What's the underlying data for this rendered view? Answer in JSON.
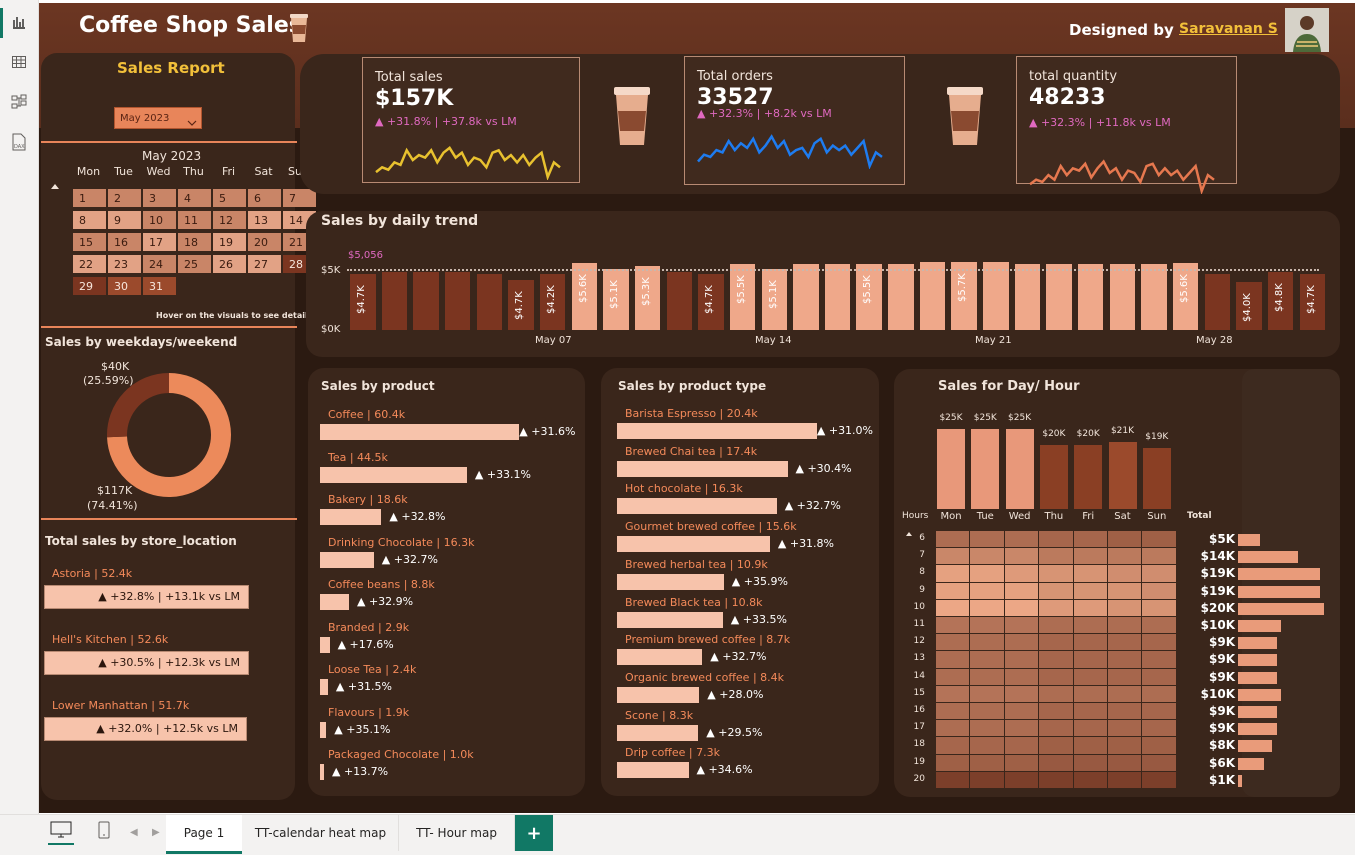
{
  "app": {
    "title": "Coffee Shop Sales",
    "designed_by_label": "Designed by",
    "designer": "Saravanan S"
  },
  "left": {
    "report_title": "Sales Report",
    "month_select": "May 2023",
    "calendar": {
      "title": "May 2023",
      "days": [
        "Mon",
        "Tue",
        "Wed",
        "Thu",
        "Fri",
        "Sat",
        "Sun"
      ],
      "dates": [
        [
          "1",
          "2",
          "3",
          "4",
          "5",
          "6",
          "7"
        ],
        [
          "8",
          "9",
          "10",
          "11",
          "12",
          "13",
          "14"
        ],
        [
          "15",
          "16",
          "17",
          "18",
          "19",
          "20",
          "21"
        ],
        [
          "22",
          "23",
          "24",
          "25",
          "26",
          "27",
          "28"
        ],
        [
          "29",
          "30",
          "31"
        ]
      ],
      "hint": "Hover on the visuals to see detail"
    },
    "weekday": {
      "title": "Sales by weekdays/weekend",
      "weekend_value": "$40K",
      "weekend_pct": "(25.59%)",
      "weekday_value": "$117K",
      "weekday_pct": "(74.41%)",
      "weekend_share": 25.59,
      "colors": {
        "weekday": "#ec8a5b",
        "weekend": "#7b3520"
      }
    },
    "store": {
      "title": "Total sales by store_location",
      "items": [
        {
          "name": "Astoria | 52.4k",
          "delta": "▲ +32.8% | +13.1k vs LM"
        },
        {
          "name": "Hell's Kitchen | 52.6k",
          "delta": "▲ +30.5% | +12.3k vs LM"
        },
        {
          "name": "Lower Manhattan | 51.7k",
          "delta": "▲ +32.0% | +12.5k vs LM"
        }
      ]
    }
  },
  "kpis": [
    {
      "name": "Total sales",
      "value": "$157K",
      "delta": "▲ +31.8% | +37.8k vs LM",
      "color": "#e8c12f",
      "spark": [
        12,
        10,
        11,
        8,
        9,
        3,
        7,
        5,
        6,
        3,
        8,
        4,
        2,
        6,
        4,
        9,
        6,
        7,
        10,
        4,
        3,
        7,
        5,
        8,
        5,
        9,
        6,
        4,
        14,
        8,
        10
      ]
    },
    {
      "name": "Total orders",
      "value": "33527",
      "delta": "▲ +32.3% | +8.2k vs LM",
      "color": "#1e7cf0",
      "spark": [
        13,
        10,
        11,
        8,
        9,
        4,
        8,
        5,
        7,
        3,
        9,
        6,
        2,
        7,
        4,
        10,
        8,
        7,
        11,
        5,
        3,
        9,
        6,
        8,
        6,
        10,
        7,
        4,
        15,
        9,
        11
      ]
    },
    {
      "name": "total quantity",
      "value": "48233",
      "delta": "▲ +32.3% | +11.8k vs LM",
      "color": "#e6784f",
      "spark": [
        12,
        10,
        11,
        8,
        10,
        4,
        8,
        5,
        6,
        3,
        9,
        5,
        2,
        7,
        5,
        10,
        6,
        7,
        11,
        4,
        3,
        8,
        5,
        8,
        6,
        10,
        7,
        4,
        15,
        8,
        10
      ]
    }
  ],
  "daily": {
    "title": "Sales by daily trend",
    "avg_label": "$5,056",
    "y_ticks": [
      "$5K",
      "$0K"
    ],
    "x_labels": [
      "May 07",
      "May 14",
      "May 21",
      "May 28"
    ],
    "bar_labels": [
      "$4.7K",
      "$4.7K",
      "$4.2K",
      "$5.6K",
      "$5.1K",
      "$5.3K",
      "$4.7K",
      "$5.5K",
      "$5.1K",
      "$5.5K",
      "$5.7K",
      "$5.6K",
      "$4.0K",
      "$4.8K",
      "$4.7K"
    ]
  },
  "chart_data": [
    {
      "type": "bar",
      "title": "Sales by daily trend",
      "x": [
        "May 1",
        "May 2",
        "May 3",
        "May 4",
        "May 5",
        "May 6",
        "May 7",
        "May 8",
        "May 9",
        "May 10",
        "May 11",
        "May 12",
        "May 13",
        "May 14",
        "May 15",
        "May 16",
        "May 17",
        "May 18",
        "May 19",
        "May 20",
        "May 21",
        "May 22",
        "May 23",
        "May 24",
        "May 25",
        "May 26",
        "May 27",
        "May 28",
        "May 29",
        "May 30",
        "May 31"
      ],
      "values": [
        4.7,
        4.8,
        4.8,
        4.8,
        4.7,
        4.2,
        4.7,
        5.6,
        5.1,
        5.3,
        4.8,
        4.7,
        5.5,
        5.1,
        5.5,
        5.5,
        5.5,
        5.5,
        5.7,
        5.7,
        5.7,
        5.5,
        5.5,
        5.5,
        5.5,
        5.5,
        5.6,
        4.7,
        4.0,
        4.8,
        4.7
      ],
      "unit": "K",
      "average": 5.056,
      "ylim": [
        0,
        5.5
      ]
    },
    {
      "type": "bar",
      "title": "Sales for Day/ Hour",
      "categories": [
        "Mon",
        "Tue",
        "Wed",
        "Thu",
        "Fri",
        "Sat",
        "Sun"
      ],
      "labels": [
        "$25K",
        "$25K",
        "$25K",
        "$20K",
        "$20K",
        "$21K",
        "$19K"
      ],
      "values": [
        25,
        25,
        25,
        20,
        20,
        21,
        19
      ]
    },
    {
      "type": "heatmap",
      "x": [
        "Mon",
        "Tue",
        "Wed",
        "Thu",
        "Fri",
        "Sat",
        "Sun"
      ],
      "y": [
        "6",
        "7",
        "8",
        "9",
        "10",
        "11",
        "12",
        "13",
        "14",
        "15",
        "16",
        "17",
        "18",
        "19",
        "20"
      ],
      "values": [
        [
          0.45,
          0.45,
          0.45,
          0.4,
          0.4,
          0.35,
          0.35
        ],
        [
          0.65,
          0.65,
          0.65,
          0.55,
          0.55,
          0.55,
          0.55
        ],
        [
          0.85,
          0.85,
          0.8,
          0.75,
          0.75,
          0.7,
          0.7
        ],
        [
          0.85,
          0.85,
          0.85,
          0.75,
          0.75,
          0.75,
          0.7
        ],
        [
          0.9,
          0.9,
          0.9,
          0.8,
          0.8,
          0.75,
          0.75
        ],
        [
          0.5,
          0.5,
          0.5,
          0.45,
          0.45,
          0.45,
          0.45
        ],
        [
          0.45,
          0.45,
          0.45,
          0.4,
          0.4,
          0.4,
          0.4
        ],
        [
          0.45,
          0.45,
          0.45,
          0.4,
          0.4,
          0.4,
          0.4
        ],
        [
          0.45,
          0.45,
          0.45,
          0.4,
          0.4,
          0.4,
          0.4
        ],
        [
          0.5,
          0.5,
          0.5,
          0.45,
          0.45,
          0.45,
          0.45
        ],
        [
          0.45,
          0.45,
          0.45,
          0.4,
          0.4,
          0.4,
          0.4
        ],
        [
          0.45,
          0.45,
          0.45,
          0.4,
          0.4,
          0.4,
          0.4
        ],
        [
          0.4,
          0.4,
          0.4,
          0.35,
          0.35,
          0.35,
          0.35
        ],
        [
          0.35,
          0.35,
          0.35,
          0.3,
          0.3,
          0.3,
          0.3
        ],
        [
          0.1,
          0.1,
          0.1,
          0.1,
          0.1,
          0.1,
          0.1
        ]
      ]
    },
    {
      "type": "bar",
      "title": "Total",
      "categories": [
        "6",
        "7",
        "8",
        "9",
        "10",
        "11",
        "12",
        "13",
        "14",
        "15",
        "16",
        "17",
        "18",
        "19",
        "20"
      ],
      "labels": [
        "$5K",
        "$14K",
        "$19K",
        "$19K",
        "$20K",
        "$10K",
        "$9K",
        "$9K",
        "$9K",
        "$10K",
        "$9K",
        "$9K",
        "$8K",
        "$6K",
        "$1K"
      ],
      "values": [
        5,
        14,
        19,
        19,
        20,
        10,
        9,
        9,
        9,
        10,
        9,
        9,
        8,
        6,
        1
      ]
    }
  ],
  "products": {
    "title": "Sales by product",
    "items": [
      {
        "label": "Coffee | 60.4k",
        "pct": "+31.6%",
        "v": 60.4
      },
      {
        "label": "Tea | 44.5k",
        "pct": "▲ +33.1%",
        "v": 44.5
      },
      {
        "label": "Bakery | 18.6k",
        "pct": "▲ +32.8%",
        "v": 18.6
      },
      {
        "label": "Drinking Chocolate | 16.3k",
        "pct": "▲ +32.7%",
        "v": 16.3
      },
      {
        "label": "Coffee beans | 8.8k",
        "pct": "▲ +32.9%",
        "v": 8.8
      },
      {
        "label": "Branded | 2.9k",
        "pct": "▲ +17.6%",
        "v": 2.9
      },
      {
        "label": "Loose Tea | 2.4k",
        "pct": "▲ +31.5%",
        "v": 2.4
      },
      {
        "label": "Flavours | 1.9k",
        "pct": "▲ +35.1%",
        "v": 1.9
      },
      {
        "label": "Packaged Chocolate | 1.0k",
        "pct": "▲ +13.7%",
        "v": 1.0
      }
    ]
  },
  "ptypes": {
    "title": "Sales by product type",
    "items": [
      {
        "label": "Barista Espresso | 20.4k",
        "pct": "+31.0%",
        "v": 20.4
      },
      {
        "label": "Brewed Chai tea | 17.4k",
        "pct": "▲ +30.4%",
        "v": 17.4
      },
      {
        "label": "Hot chocolate | 16.3k",
        "pct": "▲ +32.7%",
        "v": 16.3
      },
      {
        "label": "Gourmet brewed coffee | 15.6k",
        "pct": "▲ +31.8%",
        "v": 15.6
      },
      {
        "label": "Brewed herbal tea | 10.9k",
        "pct": "▲ +35.9%",
        "v": 10.9
      },
      {
        "label": "Brewed Black tea | 10.8k",
        "pct": "▲ +33.5%",
        "v": 10.8
      },
      {
        "label": "Premium brewed coffee | 8.7k",
        "pct": "▲ +32.7%",
        "v": 8.7
      },
      {
        "label": "Organic brewed coffee | 8.4k",
        "pct": "▲ +28.0%",
        "v": 8.4
      },
      {
        "label": "Scone | 8.3k",
        "pct": "▲ +29.5%",
        "v": 8.3
      },
      {
        "label": "Drip coffee | 7.3k",
        "pct": "▲ +34.6%",
        "v": 7.3
      }
    ]
  },
  "dayhour": {
    "title": "Sales for Day/ Hour",
    "hours_label": "Hours",
    "total_label": "Total"
  },
  "tabs": [
    "Page 1",
    "TT-calendar heat map",
    "TT- Hour map"
  ],
  "add_tab": "+"
}
